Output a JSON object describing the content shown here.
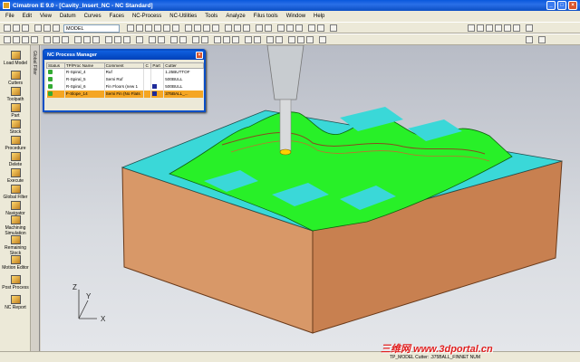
{
  "window": {
    "title": "Cimatron E 9.0 - [Cavity_Insert_NC - NC Standard]"
  },
  "menu": [
    "File",
    "Edit",
    "View",
    "Datum",
    "Curves",
    "Faces",
    "NC-Process",
    "NC-Utilities",
    "Tools",
    "Analyze",
    "Filus tools",
    "Window",
    "Help"
  ],
  "toolbar": {
    "model_combo": "MODEL"
  },
  "left_tools": [
    "Load Model",
    "Cutters",
    "Toolpath",
    "Part",
    "Stock",
    "Procedure",
    "Delete",
    "Execute",
    "Global Filter",
    "Navigator",
    "Machining Simulation",
    "Remaining Stock",
    "Motion Editor",
    "Post Process",
    "NC Report"
  ],
  "side_tab": "Global Filter",
  "ncpm": {
    "title": "NC Process Manager",
    "headers": [
      "Status",
      "TP/Proc Name",
      "Comment",
      "C",
      "Part",
      "Cutter"
    ],
    "rows": [
      {
        "name": "R-Spiral_4",
        "comment": "Ruf",
        "cutter": "1.25BUTTOF"
      },
      {
        "name": "R-Spiral_5",
        "comment": "Semi Ruf",
        "cutter": "500BULL"
      },
      {
        "name": "R-Spiral_6",
        "comment": "Fin Floors (new 1",
        "cutter": "500BULL"
      },
      {
        "name": "F-Slope_14",
        "comment": "Semi Fin (No Flats",
        "cutter": "375BALL_..."
      }
    ]
  },
  "axis": {
    "x": "X",
    "y": "Y",
    "z": "Z"
  },
  "status": {
    "text": "TP_MODEL   Cutter: .375BALL_FINNET   NUM"
  },
  "watermark": "三维网 www.3dportal.cn",
  "colors": {
    "flat_faces": "#3ad8d8",
    "slope_faces": "#28f028",
    "block": "#d89868",
    "tool": "#c8ccd0"
  }
}
